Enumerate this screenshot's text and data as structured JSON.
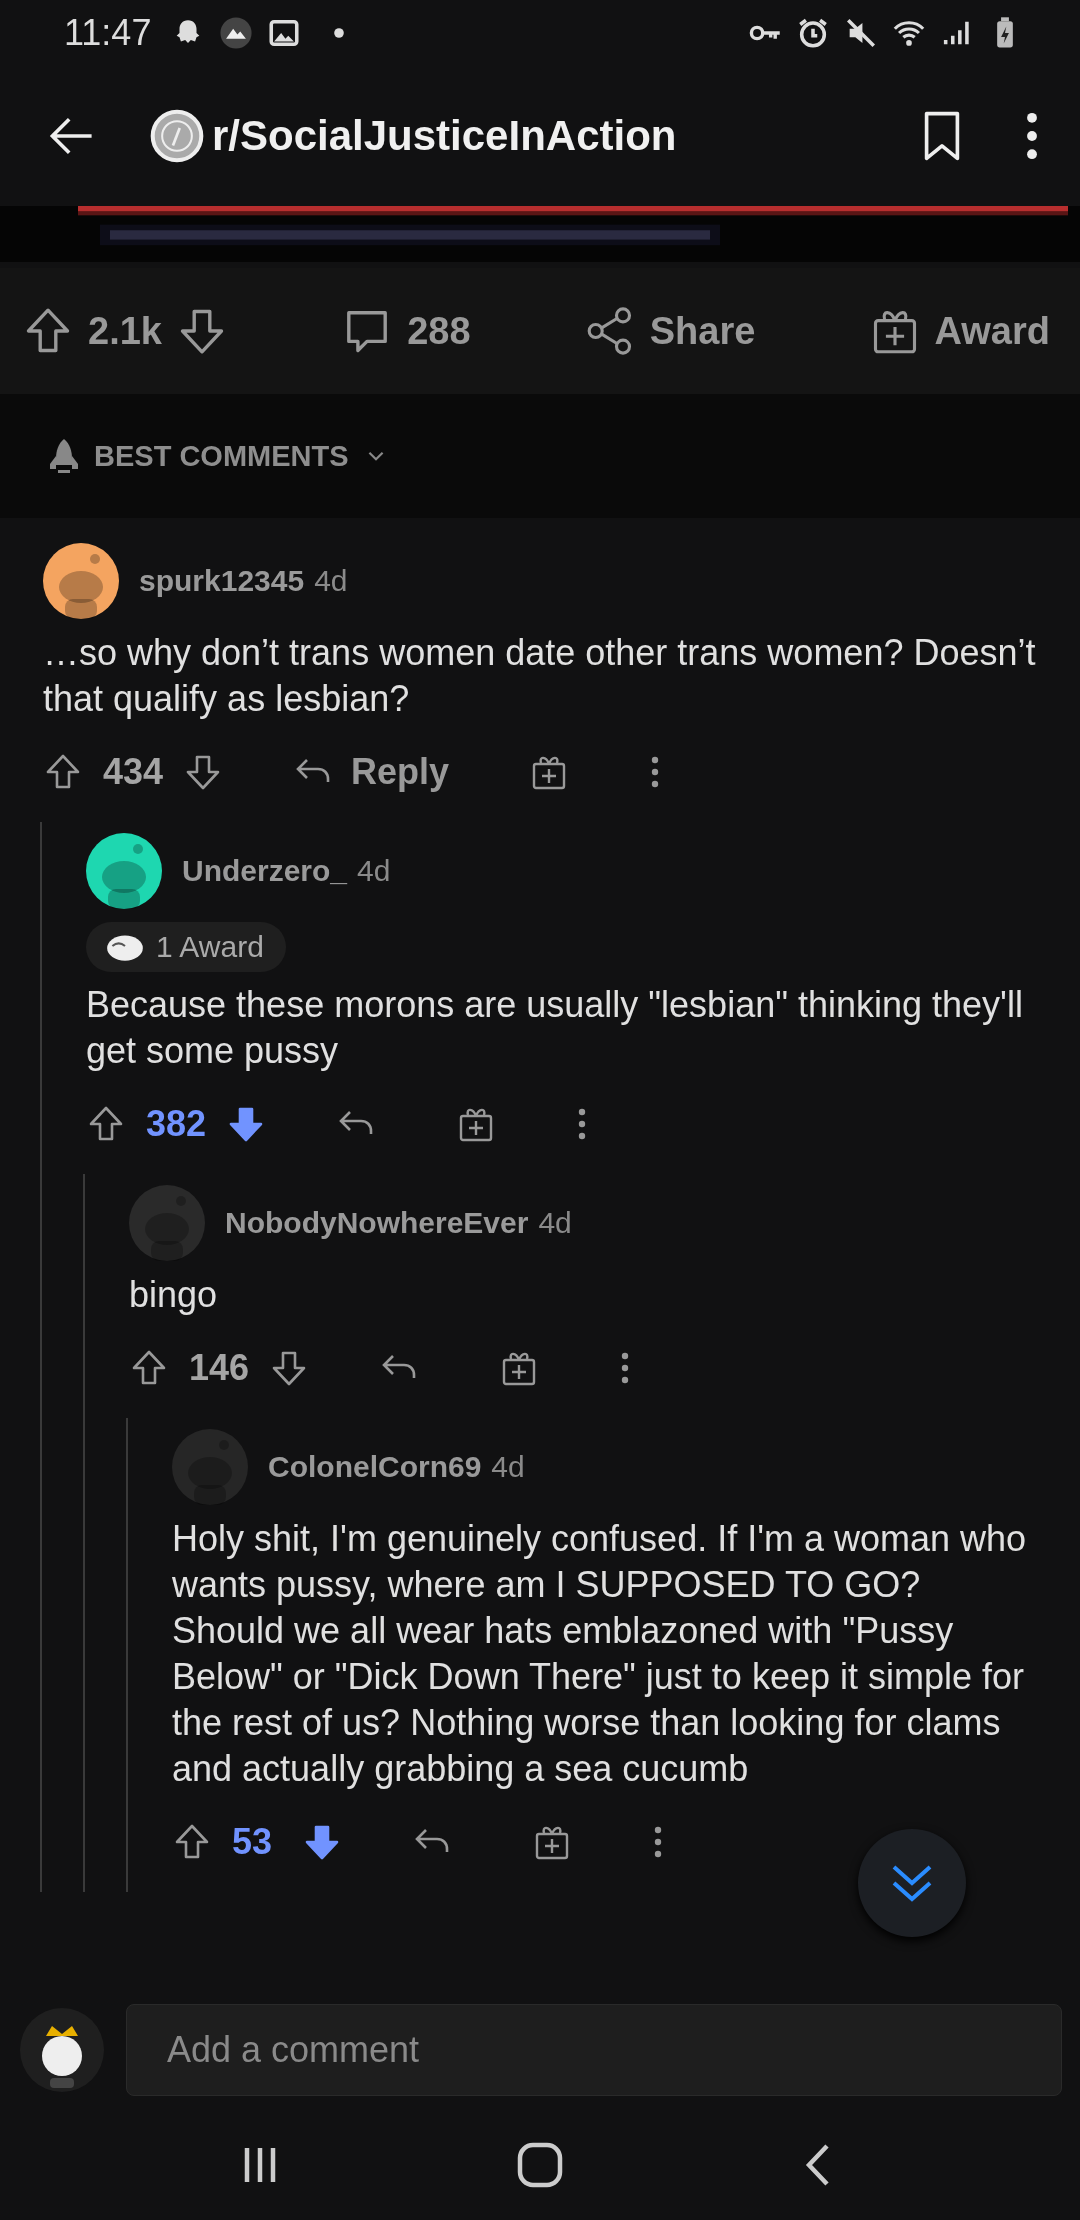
{
  "status_bar": {
    "time": "11:47"
  },
  "header": {
    "subreddit": "r/SocialJusticeInAction"
  },
  "post_actions": {
    "score": "2.1k",
    "comments": "288",
    "share": "Share",
    "award": "Award"
  },
  "sort": {
    "label": "BEST COMMENTS"
  },
  "comments": [
    {
      "author": "spurk12345",
      "age": "4d",
      "color": "#f4a460",
      "body": "…so why don’t trans women date other trans women? Doesn’t that qualify as lesbian?",
      "score": "434",
      "downvoted": false,
      "reply_label": "Reply",
      "children": [
        {
          "author": "Underzero_",
          "age": "4d",
          "color": "#1ed7b0",
          "awards": "1 Award",
          "body": "Because these morons are usually \"lesbian\" thinking they'll get some pussy",
          "score": "382",
          "downvoted": true,
          "children": [
            {
              "author": "NobodyNowhereEver",
              "age": "4d",
              "color": "#2a2a2a",
              "body": "bingo",
              "score": "146",
              "downvoted": false,
              "children": [
                {
                  "author": "ColonelCorn69",
                  "age": "4d",
                  "color": "#262626",
                  "body": "Holy shit, I'm genuinely confused. If I'm a woman who wants pussy, where am I SUPPOSED TO GO? Should we all wear hats emblazoned with \"Pussy Below\" or \"Dick Down There\" just to keep it simple for the rest of us? Nothing worse than looking for clams and actually grabbing a sea cucumb",
                  "score": "53",
                  "downvoted": true
                }
              ]
            }
          ]
        }
      ]
    }
  ],
  "composer": {
    "placeholder": "Add a comment"
  }
}
